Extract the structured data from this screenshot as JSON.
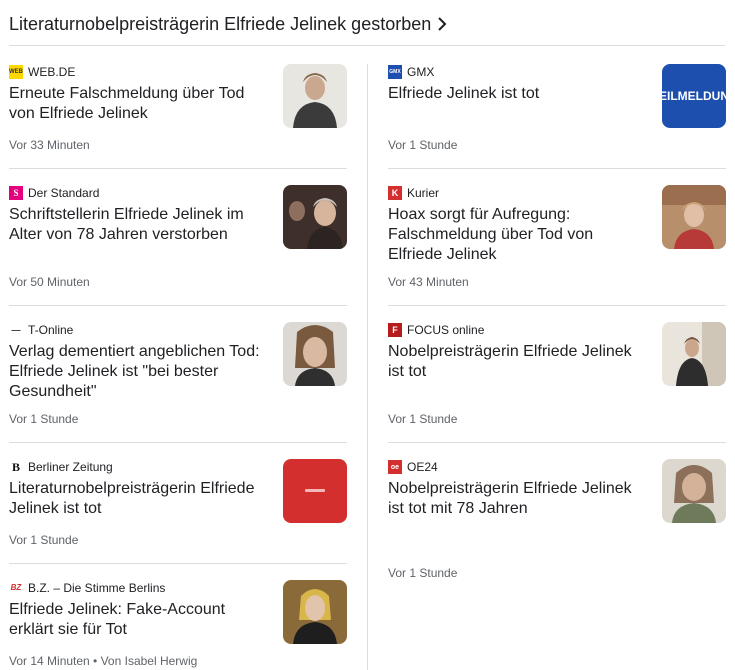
{
  "header": {
    "title": "Literaturnobelpreisträgerin Elfriede Jelinek gestorben"
  },
  "left": [
    {
      "source": "WEB.DE",
      "headline": "Erneute Falschmeldung über Tod von Elfriede Jelinek",
      "time": "Vor 33 Minuten"
    },
    {
      "source": "Der Standard",
      "headline": "Schriftstellerin Elfriede Jelinek im Alter von 78 Jahren verstorben",
      "time": "Vor 50 Minuten"
    },
    {
      "source": "T-Online",
      "headline": "Verlag dementiert angeblichen Tod: Elfriede Jelinek ist \"bei bester Gesundheit\"",
      "time": "Vor 1 Stunde"
    },
    {
      "source": "Berliner Zeitung",
      "headline": "Literaturnobelpreisträgerin Elfriede Jelinek ist tot",
      "time": "Vor 1 Stunde"
    },
    {
      "source": "B.Z. – Die Stimme Berlins",
      "headline": "Elfriede Jelinek: Fake-Account erklärt sie für Tot",
      "time": "Vor 14 Minuten • Von Isabel Herwig"
    }
  ],
  "right": [
    {
      "source": "GMX",
      "headline": "Elfriede Jelinek ist tot",
      "time": "Vor 1 Stunde",
      "thumb_text": "EILMELDUN"
    },
    {
      "source": "Kurier",
      "headline": "Hoax sorgt für Aufregung: Falschmeldung über Tod von Elfriede Jelinek",
      "time": "Vor 43 Minuten"
    },
    {
      "source": "FOCUS online",
      "headline": "Nobelpreisträgerin Elfriede Jelinek ist tot",
      "time": "Vor 1 Stunde"
    },
    {
      "source": "OE24",
      "headline": "Nobelpreisträgerin Elfriede Jelinek ist tot mit 78 Jahren",
      "time": "Vor 1 Stunde"
    }
  ],
  "logos": {
    "webde": "WEB",
    "standard": "S",
    "tonline": "—",
    "bz_berliner": "B",
    "bz": "BZ",
    "gmx": "GMX",
    "kurier": "K",
    "focus": "F",
    "oe24": "oe"
  },
  "colors": {
    "accent_red": "#d32f2f",
    "gmx_blue": "#1c4fae",
    "standard_pink": "#e4007c",
    "webde_yellow": "#ffd800"
  }
}
